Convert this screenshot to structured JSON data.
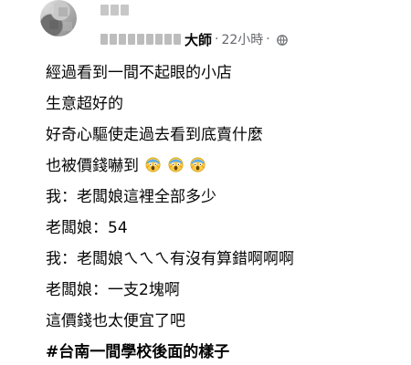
{
  "post": {
    "author_name_visible": "大師",
    "timestamp": "22小時",
    "separator": "·",
    "privacy_icon": "globe-icon",
    "lines": [
      "經過看到一間不起眼的小店",
      "生意超好的",
      "好奇心驅使走過去看到底賣什麼",
      "也被價錢嚇到",
      "我：老闆娘這裡全部多少",
      "老闆娘：54",
      "我：老闆娘ㄟㄟㄟ有沒有算錯啊啊啊",
      "老闆娘：一支2塊啊",
      "這價錢也太便宜了吧",
      "#台南一間學校後面的樣子"
    ],
    "scared_emoji": "😱😱😱",
    "emoji_icon": "screaming-face-icon"
  },
  "colors": {
    "text": "#050505",
    "meta": "#65676b",
    "blur": "#c7c7c7"
  }
}
